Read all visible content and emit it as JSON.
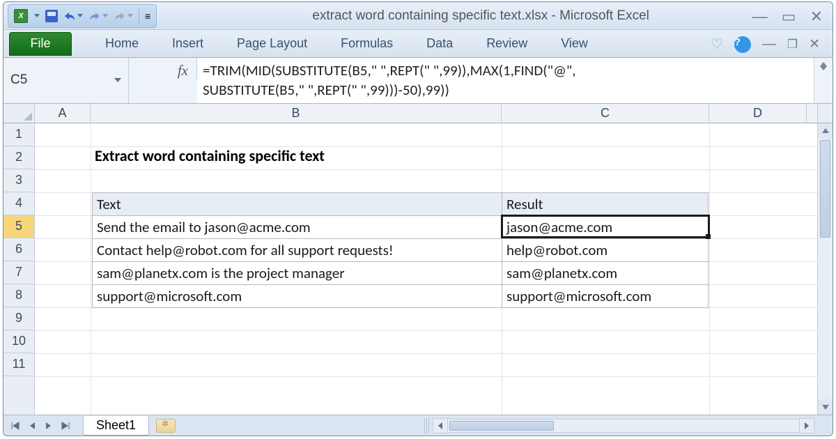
{
  "window": {
    "title": "extract word containing specific text.xlsx - Microsoft Excel"
  },
  "ribbon": {
    "file": "File",
    "tabs": [
      "Home",
      "Insert",
      "Page Layout",
      "Formulas",
      "Data",
      "Review",
      "View"
    ]
  },
  "namebox": "C5",
  "fx_label": "fx",
  "formula": "=TRIM(MID(SUBSTITUTE(B5,\" \",REPT(\" \",99)),MAX(1,FIND(\"@\",\nSUBSTITUTE(B5,\" \",REPT(\" \",99)))-50),99))",
  "columns": [
    "A",
    "B",
    "C",
    "D"
  ],
  "row_labels": [
    "1",
    "2",
    "3",
    "4",
    "5",
    "6",
    "7",
    "8",
    "9",
    "10",
    "11"
  ],
  "selected_row": "5",
  "heading": "Extract word containing specific text",
  "table": {
    "headers": {
      "text": "Text",
      "result": "Result"
    },
    "rows": [
      {
        "text": "Send the email to jason@acme.com",
        "result": "jason@acme.com"
      },
      {
        "text": "Contact help@robot.com for all support requests!",
        "result": "help@robot.com"
      },
      {
        "text": "sam@planetx.com is the project manager",
        "result": "sam@planetx.com"
      },
      {
        "text": "support@microsoft.com",
        "result": "support@microsoft.com"
      }
    ]
  },
  "sheet_tab": "Sheet1",
  "chart_data": {
    "type": "table",
    "title": "Extract word containing specific text",
    "columns": [
      "Text",
      "Result"
    ],
    "rows": [
      [
        "Send the email to jason@acme.com",
        "jason@acme.com"
      ],
      [
        "Contact help@robot.com for all support requests!",
        "help@robot.com"
      ],
      [
        "sam@planetx.com is the project manager",
        "sam@planetx.com"
      ],
      [
        "support@microsoft.com",
        "support@microsoft.com"
      ]
    ]
  }
}
